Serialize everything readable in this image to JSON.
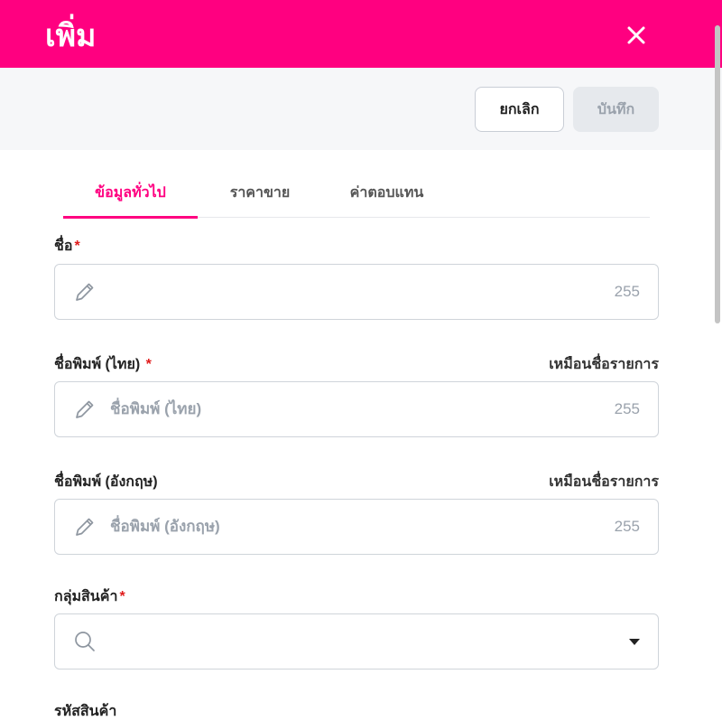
{
  "header": {
    "title": "เพิ่ม"
  },
  "toolbar": {
    "cancel_label": "ยกเลิก",
    "save_label": "บันทึก"
  },
  "tabs": [
    {
      "label": "ข้อมูลทั่วไป",
      "active": true
    },
    {
      "label": "ราคาขาย",
      "active": false
    },
    {
      "label": "ค่าตอบแทน",
      "active": false
    }
  ],
  "form": {
    "name": {
      "label": "ชื่อ",
      "required": "*",
      "value": "",
      "placeholder": "",
      "max": "255"
    },
    "print_name_th": {
      "label": "ชื่อพิมพ์ (ไทย)",
      "required": "*",
      "side_label": "เหมือนชื่อรายการ",
      "placeholder": "ชื่อพิมพ์ (ไทย)",
      "max": "255"
    },
    "print_name_en": {
      "label": "ชื่อพิมพ์ (อังกฤษ)",
      "side_label": "เหมือนชื่อรายการ",
      "placeholder": "ชื่อพิมพ์ (อังกฤษ)",
      "max": "255"
    },
    "product_group": {
      "label": "กลุ่มสินค้า",
      "required": "*",
      "value": ""
    },
    "product_code": {
      "label": "รหัสสินค้า"
    }
  },
  "icons": {
    "close": "close-icon",
    "edit": "pencil-icon",
    "search": "search-icon",
    "dropdown": "caret-down-icon"
  },
  "colors": {
    "accent": "#ff0080",
    "required": "#e01b1b",
    "placeholder": "#9aa2ac"
  }
}
